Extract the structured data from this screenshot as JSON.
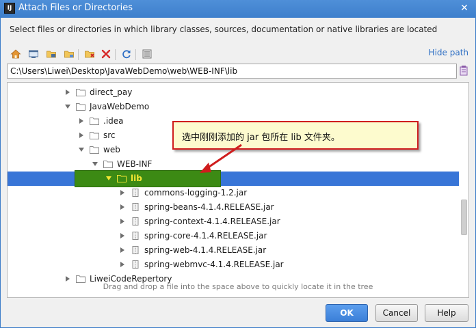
{
  "window": {
    "title": "Attach Files or Directories",
    "app_icon_text": "IJ",
    "close_glyph": "✕"
  },
  "description": "Select files or directories in which library classes, sources, documentation or native libraries are located",
  "toolbar": {
    "buttons": [
      "home-icon",
      "desktop-icon",
      "project-folder-icon",
      "module-folder-icon",
      "new-folder-icon",
      "delete-icon",
      "refresh-icon",
      "show-hidden-icon"
    ],
    "hide_path_label": "Hide path"
  },
  "path_field": {
    "value": "C:\\Users\\Liwei\\Desktop\\JavaWebDemo\\web\\WEB-INF\\lib"
  },
  "tree": {
    "items": [
      {
        "label": "direct_pay",
        "type": "folder",
        "expanded": false,
        "depth": 0
      },
      {
        "label": "JavaWebDemo",
        "type": "folder",
        "expanded": true,
        "depth": 0
      },
      {
        "label": ".idea",
        "type": "folder",
        "expanded": false,
        "depth": 1
      },
      {
        "label": "src",
        "type": "folder",
        "expanded": false,
        "depth": 1
      },
      {
        "label": "web",
        "type": "folder",
        "expanded": true,
        "depth": 1
      },
      {
        "label": "WEB-INF",
        "type": "folder",
        "expanded": true,
        "depth": 2
      },
      {
        "label": "lib",
        "type": "folder",
        "expanded": true,
        "depth": 3,
        "selected": true
      },
      {
        "label": "commons-logging-1.2.jar",
        "type": "jar",
        "expanded": false,
        "depth": 4
      },
      {
        "label": "spring-beans-4.1.4.RELEASE.jar",
        "type": "jar",
        "expanded": false,
        "depth": 4
      },
      {
        "label": "spring-context-4.1.4.RELEASE.jar",
        "type": "jar",
        "expanded": false,
        "depth": 4
      },
      {
        "label": "spring-core-4.1.4.RELEASE.jar",
        "type": "jar",
        "expanded": false,
        "depth": 4
      },
      {
        "label": "spring-web-4.1.4.RELEASE.jar",
        "type": "jar",
        "expanded": false,
        "depth": 4
      },
      {
        "label": "spring-webmvc-4.1.4.RELEASE.jar",
        "type": "jar",
        "expanded": false,
        "depth": 4
      },
      {
        "label": "LiweiCodeRepertory",
        "type": "folder",
        "expanded": false,
        "depth": 0
      }
    ]
  },
  "annotation": {
    "text": "选中刚刚添加的 jar 包所在 lib 文件夹。"
  },
  "hint": "Drag and drop a file into the space above to quickly locate it in the tree",
  "buttons": {
    "ok": "OK",
    "cancel": "Cancel",
    "help": "Help"
  },
  "colors": {
    "selection": "#3875d7",
    "callout_border": "#cf1d1d",
    "highlight": "#3c8a14",
    "title_bar": "#3d7fcc"
  }
}
